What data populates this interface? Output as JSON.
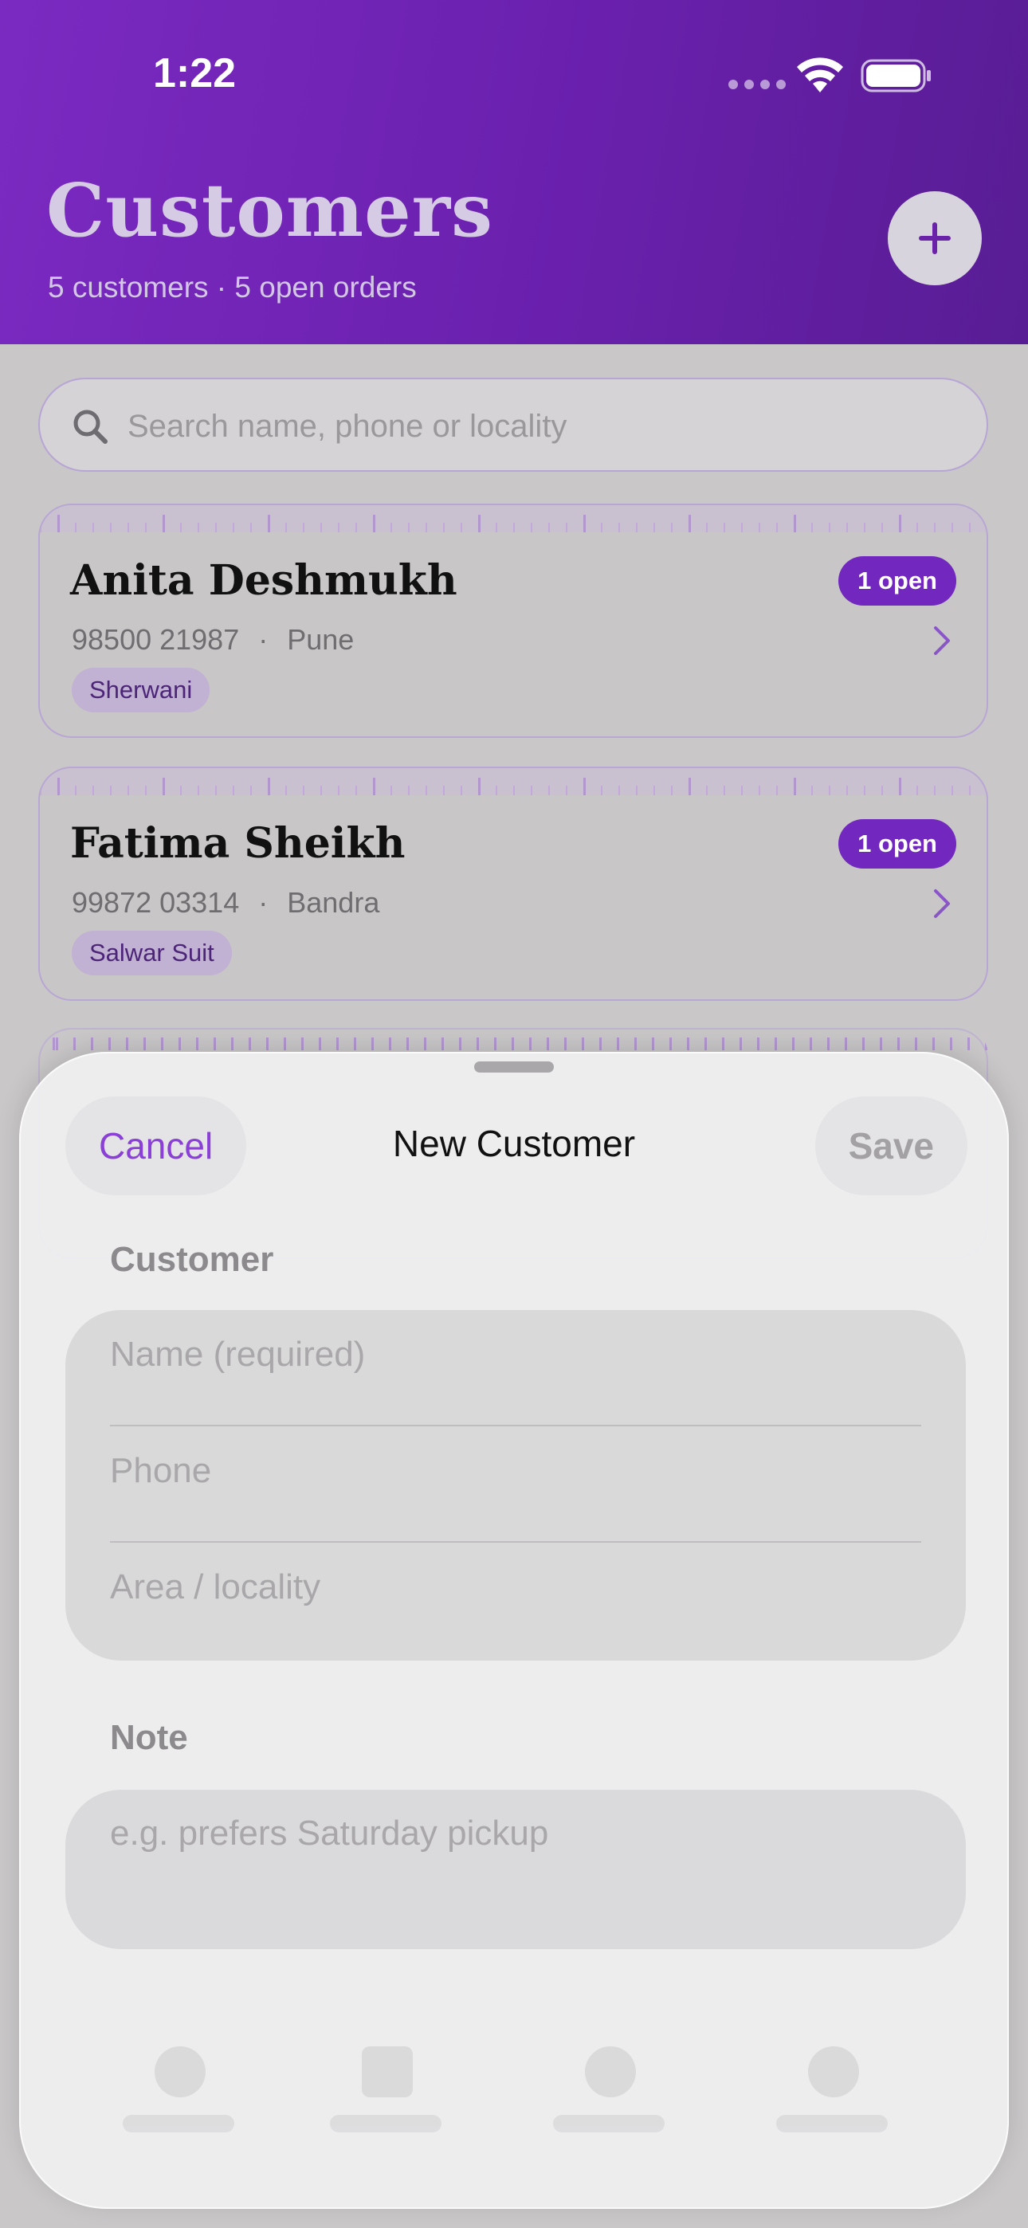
{
  "status_bar": {
    "time": "1:22"
  },
  "header": {
    "title": "Customers",
    "subtitle": "5 customers · 5 open orders"
  },
  "search": {
    "placeholder": "Search name, phone or locality"
  },
  "customers": [
    {
      "name": "Anita Deshmukh",
      "phone": "98500 21987",
      "locality": "Pune",
      "tag": "Sherwani",
      "badge": "1 open"
    },
    {
      "name": "Fatima Sheikh",
      "phone": "99872 03314",
      "locality": "Bandra",
      "tag": "Salwar Suit",
      "badge": "1 open"
    }
  ],
  "meta_separator": "·",
  "sheet": {
    "title": "New Customer",
    "cancel_label": "Cancel",
    "save_label": "Save",
    "customer_section_label": "Customer",
    "name_placeholder": "Name (required)",
    "phone_placeholder": "Phone",
    "area_placeholder": "Area / locality",
    "note_section_label": "Note",
    "note_placeholder": "e.g. prefers Saturday pickup"
  },
  "colors": {
    "header_gradient_start": "#7b2ac1",
    "header_gradient_end": "#581d94",
    "accent": "#7228bf",
    "cancel_text": "#8a3fd6"
  },
  "icons": [
    "wifi-icon",
    "battery-icon",
    "plus-icon",
    "search-icon",
    "chevron-right-icon"
  ]
}
